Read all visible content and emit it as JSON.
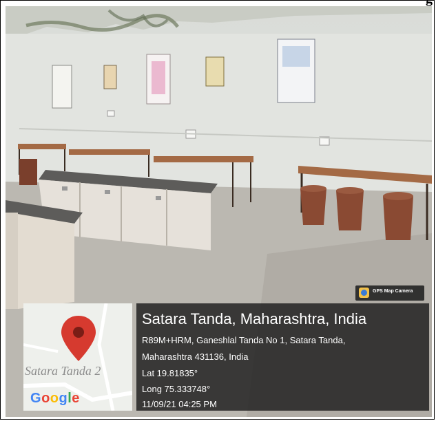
{
  "header": {
    "fragment": "g"
  },
  "photo": {
    "subject": ""
  },
  "badge": {
    "label": "GPS Map Camera",
    "icon": "gps-map-camera-icon"
  },
  "map": {
    "place_label": "Satara Tanda 2",
    "google_label": "Google",
    "pin_icon": "map-pin-icon"
  },
  "location": {
    "title": "Satara Tanda, Maharashtra, India",
    "address_line1": "R89M+HRM, Ganeshlal Tanda No 1, Satara Tanda,",
    "address_line2": "Maharashtra 431136, India",
    "lat": "Lat 19.81835°",
    "long": "Long 75.333748°",
    "datetime": "11/09/21 04:25 PM"
  },
  "colors": {
    "overlay": "#232323",
    "pin": "#d63a2f",
    "google_blue": "#4285f4",
    "google_red": "#ea4335",
    "google_yellow": "#fbbc05",
    "google_green": "#34a853"
  }
}
